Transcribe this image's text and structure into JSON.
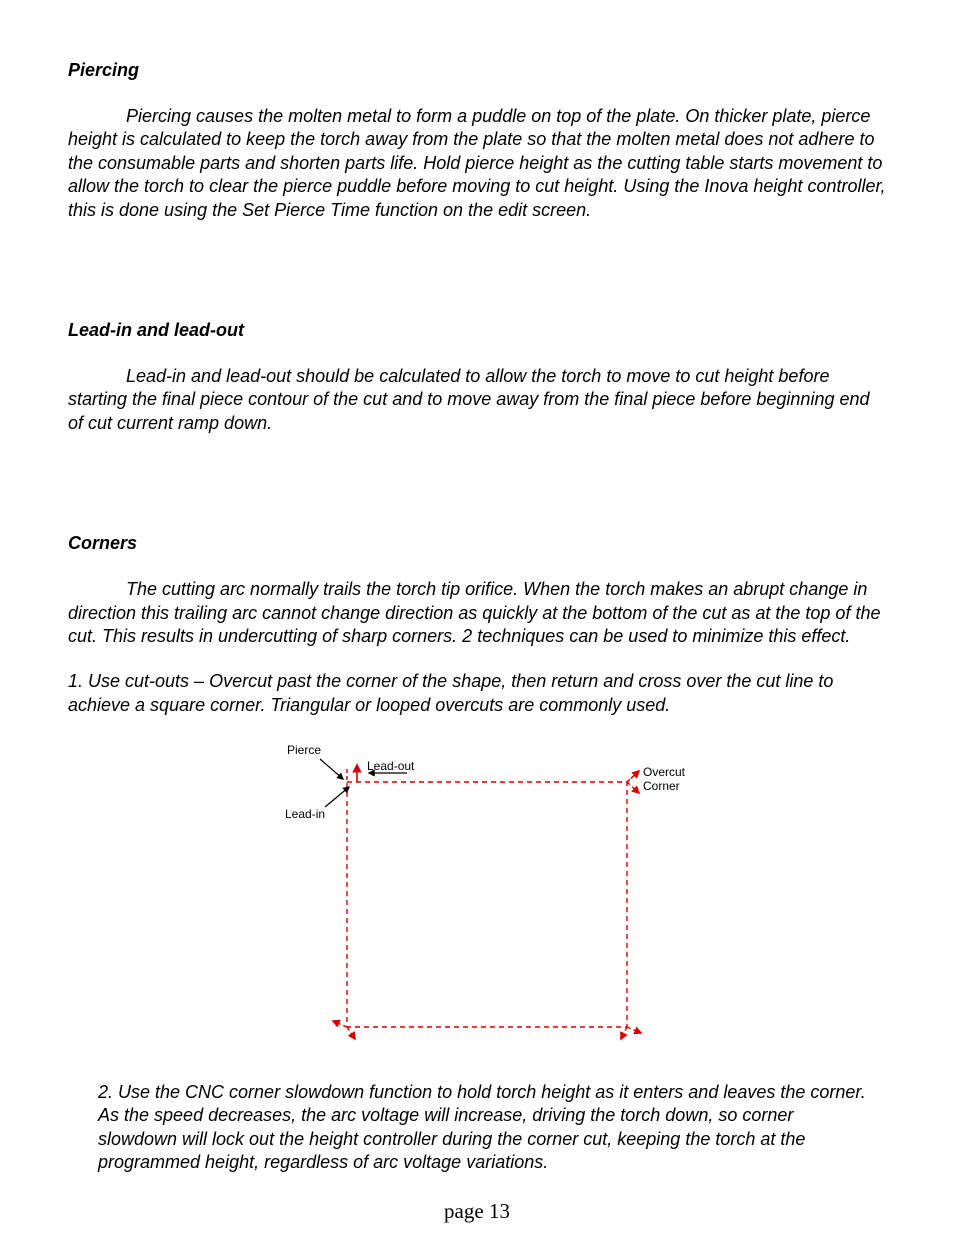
{
  "sections": {
    "piercing": {
      "heading": "Piercing",
      "body": "Piercing causes the molten metal to form a puddle on top of the plate.  On thicker plate, pierce height is calculated to keep the torch away from the plate so that the molten metal does not adhere to the consumable parts and shorten parts life.  Hold pierce height as the cutting table starts movement to allow the torch to clear the pierce puddle before moving to cut height.  Using the Inova height controller, this is done using the Set Pierce Time function on the edit screen."
    },
    "leadinout": {
      "heading": "Lead-in and lead-out",
      "body": "Lead-in and lead-out should be calculated to allow the torch to move to cut height before starting the final piece contour of the cut and to move away from the final piece before beginning end of cut current ramp down."
    },
    "corners": {
      "heading": "Corners",
      "body": "The cutting arc normally trails the torch tip orifice.  When the torch makes an abrupt change in direction this trailing arc cannot change direction as quickly at the bottom of the cut as at the top of the cut.  This results in undercutting of sharp corners.  2 techniques can be used to minimize this effect.",
      "item1": "1.  Use cut-outs – Overcut past the corner of the shape, then return and cross over the cut line to achieve a square corner.  Triangular or looped overcuts are commonly used.",
      "item2": "2.  Use the CNC corner slowdown function to hold torch height as it enters and leaves the corner.  As the speed decreases, the arc voltage will increase, driving the torch down, so corner slowdown will lock out the height controller during the corner cut, keeping the torch at the programmed height, regardless of arc voltage variations."
    }
  },
  "diagram": {
    "labels": {
      "pierce": "Pierce",
      "leadin": "Lead-in",
      "leadout": "Lead-out",
      "overcut1": "Overcut",
      "overcut2": "Corner"
    }
  },
  "footer": "page 13"
}
